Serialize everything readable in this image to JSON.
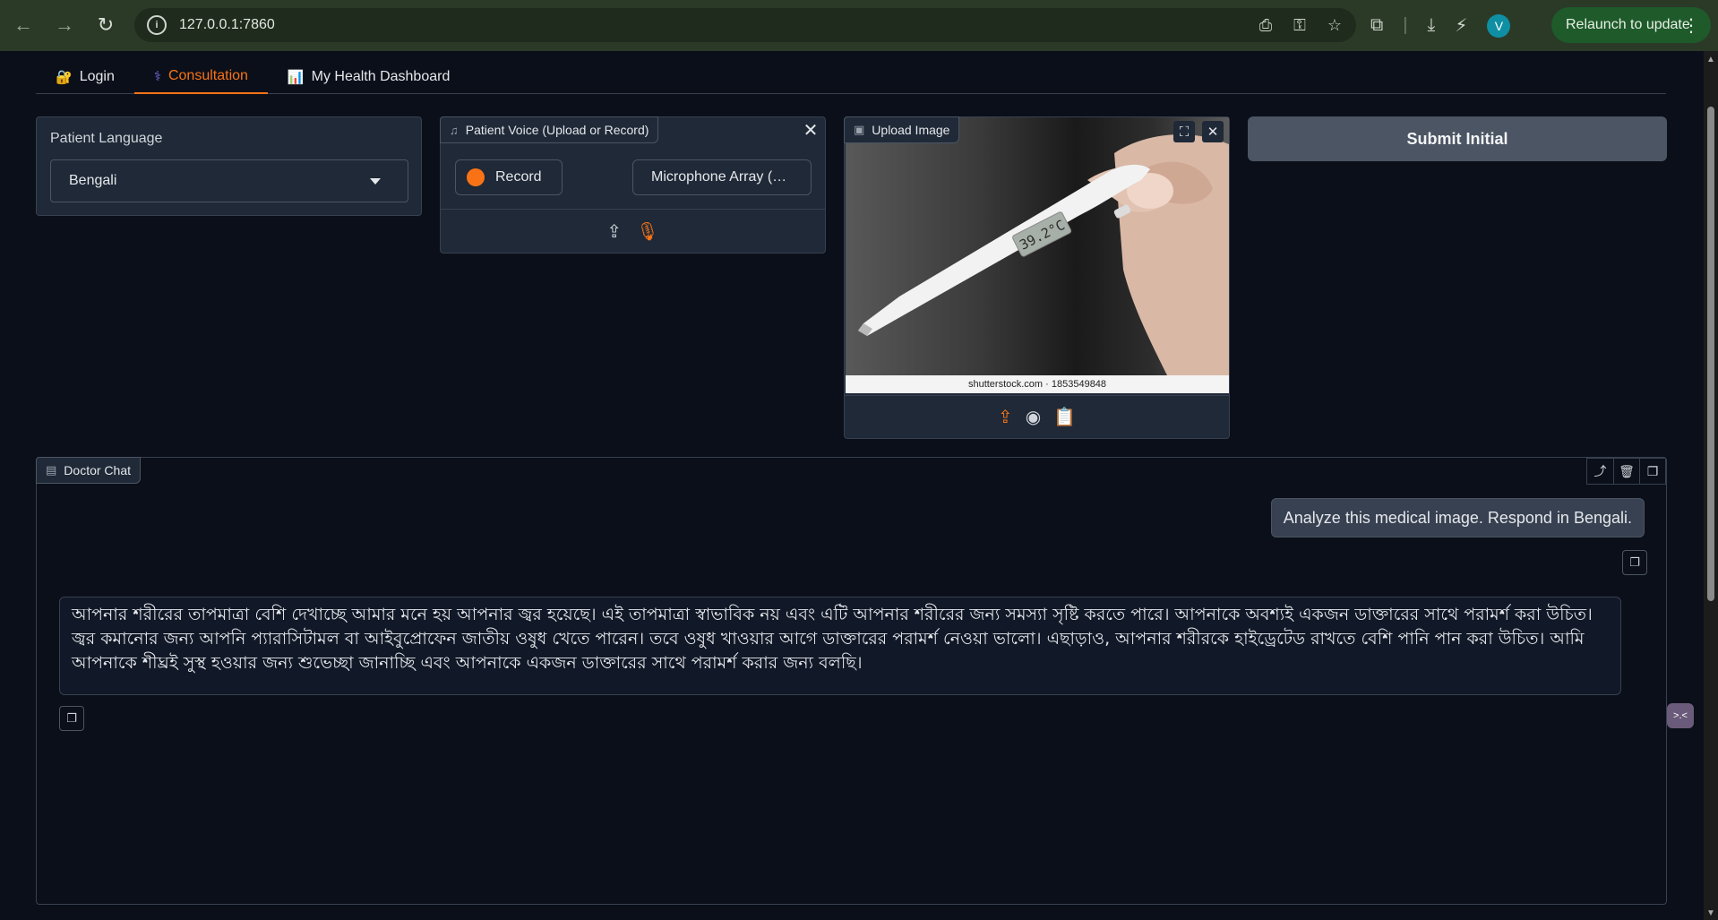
{
  "browser": {
    "url": "127.0.0.1:7860",
    "avatar_letter": "V",
    "relaunch_label": "Relaunch to update"
  },
  "tabs": [
    {
      "label": "Login",
      "icon": "lock-key-icon",
      "active": false
    },
    {
      "label": "Consultation",
      "icon": "stethoscope-icon",
      "active": true
    },
    {
      "label": "My Health Dashboard",
      "icon": "bar-chart-icon",
      "active": false
    }
  ],
  "language": {
    "label": "Patient Language",
    "selected": "Bengali"
  },
  "voice": {
    "label": "Patient Voice (Upload or Record)",
    "record_label": "Record",
    "device_label": "Microphone Array (…"
  },
  "image": {
    "label": "Upload Image",
    "thermometer_reading": "39.2°C",
    "credit": "shutterstock.com · 1853549848"
  },
  "submit_label": "Submit Initial",
  "chat": {
    "label": "Doctor Chat",
    "user_message": "Analyze this medical image. Respond in Bengali.",
    "bot_message": "আপনার শরীরের তাপমাত্রা বেশি দেখাচ্ছে আমার মনে হয় আপনার জ্বর হয়েছে। এই তাপমাত্রা স্বাভাবিক নয় এবং এটি আপনার শরীরের জন্য সমস্যা সৃষ্টি করতে পারে। আপনাকে অবশ্যই একজন ডাক্তারের সাথে পরামর্শ করা উচিত। জ্বর কমানোর জন্য আপনি প্যারাসিটামল বা আইবুপ্রোফেন জাতীয় ওষুধ খেতে পারেন। তবে ওষুধ খাওয়ার আগে ডাক্তারের পরামর্শ নেওয়া ভালো। এছাড়াও, আপনার শরীরকে হাইড্রেটেড রাখতে বেশি পানি পান করা উচিত। আমি আপনাকে শীঘ্রই সুস্থ হওয়ার জন্য শুভেচ্ছা জানাচ্ছি এবং আপনাকে একজন ডাক্তারের সাথে পরামর্শ করার জন্য বলছি।"
  },
  "colors": {
    "accent": "#f97316",
    "background": "#0b0f19",
    "panel": "#1f2937"
  }
}
